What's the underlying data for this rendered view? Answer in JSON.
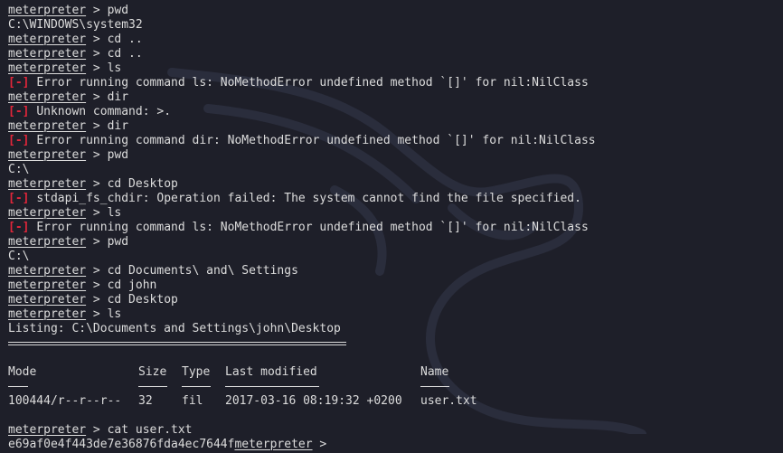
{
  "prompt": "meterpreter",
  "error_tag": "[-]",
  "lines": [
    {
      "kind": "cmd",
      "cmd": "pwd"
    },
    {
      "kind": "out",
      "text": "C:\\WINDOWS\\system32"
    },
    {
      "kind": "cmd",
      "cmd": "cd .."
    },
    {
      "kind": "cmd",
      "cmd": "cd .."
    },
    {
      "kind": "cmd",
      "cmd": "ls"
    },
    {
      "kind": "err",
      "text": "Error running command ls: NoMethodError undefined method `[]' for nil:NilClass"
    },
    {
      "kind": "cmd",
      "cmd": "dir"
    },
    {
      "kind": "err",
      "text": "Unknown command: >."
    },
    {
      "kind": "cmd",
      "cmd": "dir"
    },
    {
      "kind": "err",
      "text": "Error running command dir: NoMethodError undefined method `[]' for nil:NilClass"
    },
    {
      "kind": "cmd",
      "cmd": "pwd"
    },
    {
      "kind": "out",
      "text": "C:\\"
    },
    {
      "kind": "cmd",
      "cmd": "cd Desktop"
    },
    {
      "kind": "err",
      "text": "stdapi_fs_chdir: Operation failed: The system cannot find the file specified."
    },
    {
      "kind": "cmd",
      "cmd": "ls"
    },
    {
      "kind": "err",
      "text": "Error running command ls: NoMethodError undefined method `[]' for nil:NilClass"
    },
    {
      "kind": "cmd",
      "cmd": "pwd"
    },
    {
      "kind": "out",
      "text": "C:\\"
    },
    {
      "kind": "cmd",
      "cmd": "cd Documents\\ and\\ Settings"
    },
    {
      "kind": "cmd",
      "cmd": "cd john"
    },
    {
      "kind": "cmd",
      "cmd": "cd Desktop"
    },
    {
      "kind": "cmd",
      "cmd": "ls"
    },
    {
      "kind": "out",
      "text": "Listing: C:\\Documents and Settings\\john\\Desktop"
    }
  ],
  "listing": {
    "headers": [
      "Mode",
      "Size",
      "Type",
      "Last modified",
      "Name"
    ],
    "rows": [
      [
        "100444/r--r--r--",
        "32",
        "fil",
        "2017-03-16 08:19:32 +0200",
        "user.txt"
      ]
    ]
  },
  "final_cmd": "cat user.txt",
  "final_output": "e69af0e4f443de7e36876fda4ec7644f",
  "colors": {
    "background": "#1e1f29",
    "text": "#dcdcdc",
    "error": "#e2263a"
  }
}
